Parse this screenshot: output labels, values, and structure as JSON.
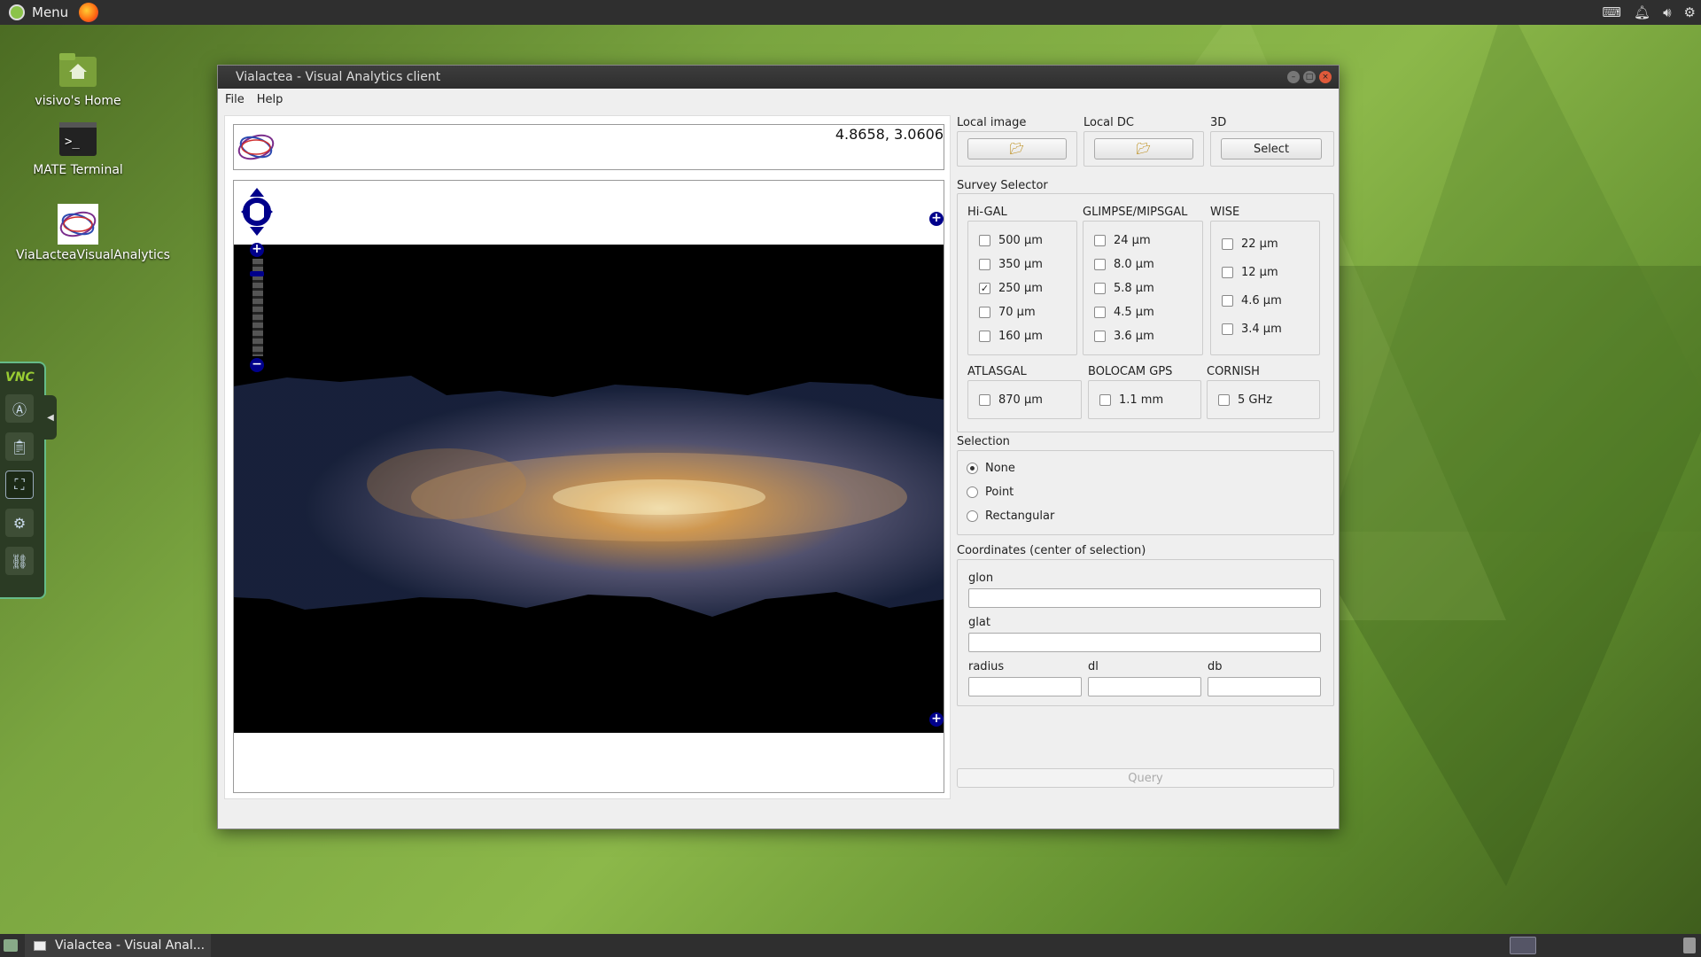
{
  "panel": {
    "menu_label": "Menu"
  },
  "desktop": {
    "icons": [
      {
        "label": "visivo's Home"
      },
      {
        "label": "MATE Terminal"
      },
      {
        "label": "ViaLacteaVisualAnalytics"
      }
    ]
  },
  "vnc": {
    "logo": "VNC"
  },
  "window": {
    "title": "Vialactea - Visual Analytics client",
    "menu": [
      "File",
      "Help"
    ],
    "coords_display": "4.8658, 3.0606"
  },
  "right": {
    "local_image_label": "Local image",
    "local_dc_label": "Local DC",
    "three_d_label": "3D",
    "select_button": "Select",
    "survey_selector_label": "Survey Selector",
    "higal": {
      "title": "Hi-GAL",
      "items": [
        {
          "label": "500 µm",
          "checked": false
        },
        {
          "label": "350 µm",
          "checked": false
        },
        {
          "label": "250 µm",
          "checked": true
        },
        {
          "label": "70 µm",
          "checked": false
        },
        {
          "label": "160 µm",
          "checked": false
        }
      ]
    },
    "glimpse": {
      "title": "GLIMPSE/MIPSGAL",
      "items": [
        {
          "label": "24 µm",
          "checked": false
        },
        {
          "label": "8.0 µm",
          "checked": false
        },
        {
          "label": "5.8 µm",
          "checked": false
        },
        {
          "label": "4.5 µm",
          "checked": false
        },
        {
          "label": "3.6 µm",
          "checked": false
        }
      ]
    },
    "wise": {
      "title": "WISE",
      "items": [
        {
          "label": "22 µm",
          "checked": false
        },
        {
          "label": "12 µm",
          "checked": false
        },
        {
          "label": "4.6 µm",
          "checked": false
        },
        {
          "label": "3.4 µm",
          "checked": false
        }
      ]
    },
    "atlasgal": {
      "title": "ATLASGAL",
      "item": "870 µm"
    },
    "bolocam": {
      "title": "BOLOCAM GPS",
      "item": "1.1 mm"
    },
    "cornish": {
      "title": "CORNISH",
      "item": "5 GHz"
    },
    "selection_label": "Selection",
    "selection": {
      "options": [
        "None",
        "Point",
        "Rectangular"
      ],
      "selected": "None"
    },
    "coordinates_label": "Coordinates (center of selection)",
    "glon_label": "glon",
    "glat_label": "glat",
    "radius_label": "radius",
    "dl_label": "dl",
    "db_label": "db",
    "query_button": "Query"
  },
  "taskbar": {
    "item": "Vialactea - Visual Anal..."
  }
}
